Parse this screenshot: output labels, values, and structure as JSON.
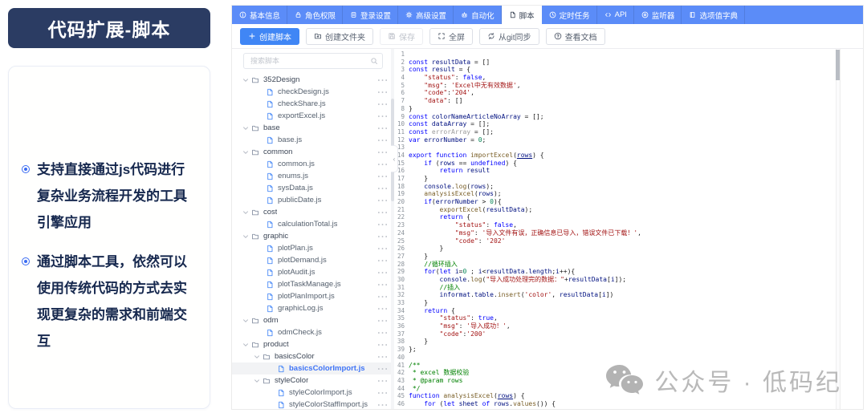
{
  "left_panel": {
    "title": "代码扩展-脚本",
    "bullets": [
      "支持直接通过js代码进行复杂业务流程开发的工具引擎应用",
      "通过脚本工具，依然可以使用传统代码的方式去实现更复杂的需求和前端交互"
    ]
  },
  "tabs": [
    {
      "id": "basic-info",
      "label": "基本信息",
      "icon": "info-icon",
      "active": false
    },
    {
      "id": "role-permission",
      "label": "角色权限",
      "icon": "lock-icon",
      "active": false
    },
    {
      "id": "login-settings",
      "label": "登录设置",
      "icon": "login-icon",
      "active": false
    },
    {
      "id": "advanced-settings",
      "label": "高级设置",
      "icon": "gear-icon",
      "active": false
    },
    {
      "id": "automation",
      "label": "自动化",
      "icon": "automation-icon",
      "active": false
    },
    {
      "id": "script",
      "label": "脚本",
      "icon": "script-icon",
      "active": true
    },
    {
      "id": "scheduled-tasks",
      "label": "定时任务",
      "icon": "clock-icon",
      "active": false
    },
    {
      "id": "api",
      "label": "API",
      "icon": "api-icon",
      "active": false
    },
    {
      "id": "listener",
      "label": "监听器",
      "icon": "monitor-icon",
      "active": false
    },
    {
      "id": "option-dict",
      "label": "选项值字典",
      "icon": "dict-icon",
      "active": false
    }
  ],
  "toolbar": [
    {
      "id": "create-script",
      "label": "创建脚本",
      "icon": "plus-icon",
      "style": "primary"
    },
    {
      "id": "create-folder",
      "label": "创建文件夹",
      "icon": "folder-add-icon",
      "style": "normal"
    },
    {
      "id": "save",
      "label": "保存",
      "icon": "save-icon",
      "style": "disabled"
    },
    {
      "id": "fullscreen",
      "label": "全屏",
      "icon": "fullscreen-icon",
      "style": "normal"
    },
    {
      "id": "git-sync",
      "label": "从git同步",
      "icon": "git-sync-icon",
      "style": "normal"
    },
    {
      "id": "view-docs",
      "label": "查看文档",
      "icon": "doc-icon",
      "style": "normal"
    }
  ],
  "file_tree": {
    "search_placeholder": "搜索脚本",
    "items": [
      {
        "type": "folder",
        "name": "352Design",
        "depth": 0
      },
      {
        "type": "file",
        "name": "checkDesign.js",
        "depth": 1
      },
      {
        "type": "file",
        "name": "checkShare.js",
        "depth": 1
      },
      {
        "type": "file",
        "name": "exportExcel.js",
        "depth": 1
      },
      {
        "type": "folder",
        "name": "base",
        "depth": 0
      },
      {
        "type": "file",
        "name": "base.js",
        "depth": 1
      },
      {
        "type": "folder",
        "name": "common",
        "depth": 0
      },
      {
        "type": "file",
        "name": "common.js",
        "depth": 1
      },
      {
        "type": "file",
        "name": "enums.js",
        "depth": 1
      },
      {
        "type": "file",
        "name": "sysData.js",
        "depth": 1
      },
      {
        "type": "file",
        "name": "publicDate.js",
        "depth": 1
      },
      {
        "type": "folder",
        "name": "cost",
        "depth": 0
      },
      {
        "type": "file",
        "name": "calculationTotal.js",
        "depth": 1
      },
      {
        "type": "folder",
        "name": "graphic",
        "depth": 0
      },
      {
        "type": "file",
        "name": "plotPlan.js",
        "depth": 1
      },
      {
        "type": "file",
        "name": "plotDemand.js",
        "depth": 1
      },
      {
        "type": "file",
        "name": "plotAudit.js",
        "depth": 1
      },
      {
        "type": "file",
        "name": "plotTaskManage.js",
        "depth": 1
      },
      {
        "type": "file",
        "name": "plotPlanImport.js",
        "depth": 1
      },
      {
        "type": "file",
        "name": "graphicLog.js",
        "depth": 1
      },
      {
        "type": "folder",
        "name": "odm",
        "depth": 0
      },
      {
        "type": "file",
        "name": "odmCheck.js",
        "depth": 1
      },
      {
        "type": "folder",
        "name": "product",
        "depth": 0
      },
      {
        "type": "folder",
        "name": "basicsColor",
        "depth": 1
      },
      {
        "type": "file",
        "name": "basicsColorImport.js",
        "depth": 2,
        "selected": true
      },
      {
        "type": "folder",
        "name": "styleColor",
        "depth": 1
      },
      {
        "type": "file",
        "name": "styleColorImport.js",
        "depth": 2
      },
      {
        "type": "file",
        "name": "styleColorStaffImport.js",
        "depth": 2
      }
    ]
  },
  "editor": {
    "lines": [
      [],
      [
        [
          "k",
          "const"
        ],
        [
          "p",
          " "
        ],
        [
          "t",
          "resultData"
        ],
        [
          "p",
          " = []"
        ]
      ],
      [
        [
          "k",
          "const"
        ],
        [
          "p",
          " "
        ],
        [
          "t",
          "result"
        ],
        [
          "p",
          " = {"
        ]
      ],
      [
        [
          "p",
          "    "
        ],
        [
          "s",
          "\"status\""
        ],
        [
          "p",
          ": "
        ],
        [
          "k",
          "false"
        ],
        [
          "p",
          ","
        ]
      ],
      [
        [
          "p",
          "    "
        ],
        [
          "s",
          "\"msg\""
        ],
        [
          "p",
          ": "
        ],
        [
          "s",
          "'Excel中无有效数据'"
        ],
        [
          "p",
          ","
        ]
      ],
      [
        [
          "p",
          "    "
        ],
        [
          "s",
          "\"code\""
        ],
        [
          "p",
          ":"
        ],
        [
          "s",
          "'204'"
        ],
        [
          "p",
          ","
        ]
      ],
      [
        [
          "p",
          "    "
        ],
        [
          "s",
          "\"data\""
        ],
        [
          "p",
          ": []"
        ]
      ],
      [
        [
          "p",
          "}"
        ]
      ],
      [
        [
          "k",
          "const"
        ],
        [
          "p",
          " "
        ],
        [
          "t",
          "colorNameArticleNoArray"
        ],
        [
          "p",
          " = [];"
        ]
      ],
      [
        [
          "k",
          "const"
        ],
        [
          "p",
          " "
        ],
        [
          "t",
          "dataArray"
        ],
        [
          "p",
          " = [];"
        ]
      ],
      [
        [
          "k",
          "const"
        ],
        [
          "p",
          " "
        ],
        [
          "g",
          "errorArray"
        ],
        [
          "p",
          " = [];"
        ]
      ],
      [
        [
          "k",
          "var"
        ],
        [
          "p",
          " "
        ],
        [
          "t",
          "errorNumber"
        ],
        [
          "p",
          " = "
        ],
        [
          "n",
          "0"
        ],
        [
          "p",
          ";"
        ]
      ],
      [],
      [
        [
          "k",
          "export"
        ],
        [
          "p",
          " "
        ],
        [
          "k",
          "function"
        ],
        [
          "p",
          " "
        ],
        [
          "f",
          "importExcel"
        ],
        [
          "p",
          "("
        ],
        [
          "u",
          "rows"
        ],
        [
          "p",
          ") {"
        ]
      ],
      [
        [
          "p",
          "    "
        ],
        [
          "k",
          "if"
        ],
        [
          "p",
          " ("
        ],
        [
          "t",
          "rows"
        ],
        [
          "p",
          " == "
        ],
        [
          "k",
          "undefined"
        ],
        [
          "p",
          ") {"
        ]
      ],
      [
        [
          "p",
          "        "
        ],
        [
          "k",
          "return"
        ],
        [
          "p",
          " "
        ],
        [
          "t",
          "result"
        ]
      ],
      [
        [
          "p",
          "    }"
        ]
      ],
      [
        [
          "p",
          "    "
        ],
        [
          "t",
          "console"
        ],
        [
          "p",
          "."
        ],
        [
          "f",
          "log"
        ],
        [
          "p",
          "("
        ],
        [
          "t",
          "rows"
        ],
        [
          "p",
          ");"
        ]
      ],
      [
        [
          "p",
          "    "
        ],
        [
          "f",
          "analysisExcel"
        ],
        [
          "p",
          "("
        ],
        [
          "t",
          "rows"
        ],
        [
          "p",
          ");"
        ]
      ],
      [
        [
          "p",
          "    "
        ],
        [
          "k",
          "if"
        ],
        [
          "p",
          "("
        ],
        [
          "t",
          "errorNumber"
        ],
        [
          "p",
          " > "
        ],
        [
          "n",
          "0"
        ],
        [
          "p",
          "){"
        ]
      ],
      [
        [
          "p",
          "        "
        ],
        [
          "f",
          "exportExcel"
        ],
        [
          "p",
          "("
        ],
        [
          "t",
          "resultData"
        ],
        [
          "p",
          ");"
        ]
      ],
      [
        [
          "p",
          "        "
        ],
        [
          "k",
          "return"
        ],
        [
          "p",
          " {"
        ]
      ],
      [
        [
          "p",
          "            "
        ],
        [
          "s",
          "\"status\""
        ],
        [
          "p",
          ": "
        ],
        [
          "k",
          "false"
        ],
        [
          "p",
          ","
        ]
      ],
      [
        [
          "p",
          "            "
        ],
        [
          "s",
          "\"msg\""
        ],
        [
          "p",
          ": "
        ],
        [
          "s",
          "'导入文件有误，正确信息已导入，错误文件已下载！'"
        ],
        [
          "p",
          ","
        ]
      ],
      [
        [
          "p",
          "            "
        ],
        [
          "s",
          "\"code\""
        ],
        [
          "p",
          ": "
        ],
        [
          "s",
          "'202'"
        ]
      ],
      [
        [
          "p",
          "        }"
        ]
      ],
      [
        [
          "p",
          "    }"
        ]
      ],
      [
        [
          "p",
          "    "
        ],
        [
          "c",
          "//循环插入"
        ]
      ],
      [
        [
          "p",
          "    "
        ],
        [
          "k",
          "for"
        ],
        [
          "p",
          "("
        ],
        [
          "k",
          "let"
        ],
        [
          "p",
          " "
        ],
        [
          "t",
          "i"
        ],
        [
          "p",
          "="
        ],
        [
          "n",
          "0"
        ],
        [
          "p",
          " ; "
        ],
        [
          "t",
          "i"
        ],
        [
          "p",
          "<"
        ],
        [
          "t",
          "resultData"
        ],
        [
          "p",
          "."
        ],
        [
          "t",
          "length"
        ],
        [
          "p",
          ";"
        ],
        [
          "t",
          "i"
        ],
        [
          "p",
          "++){"
        ]
      ],
      [
        [
          "p",
          "        "
        ],
        [
          "t",
          "console"
        ],
        [
          "p",
          "."
        ],
        [
          "f",
          "log"
        ],
        [
          "p",
          "("
        ],
        [
          "s",
          "\"导入成功处理完的数据：\""
        ],
        [
          "p",
          "+"
        ],
        [
          "t",
          "resultData"
        ],
        [
          "p",
          "["
        ],
        [
          "t",
          "i"
        ],
        [
          "p",
          "]);"
        ]
      ],
      [
        [
          "p",
          "        "
        ],
        [
          "c",
          "//插入"
        ]
      ],
      [
        [
          "p",
          "        "
        ],
        [
          "t",
          "informat"
        ],
        [
          "p",
          "."
        ],
        [
          "t",
          "table"
        ],
        [
          "p",
          "."
        ],
        [
          "f",
          "insert"
        ],
        [
          "p",
          "("
        ],
        [
          "s",
          "'color'"
        ],
        [
          "p",
          ", "
        ],
        [
          "t",
          "resultData"
        ],
        [
          "p",
          "["
        ],
        [
          "t",
          "i"
        ],
        [
          "p",
          "])"
        ]
      ],
      [
        [
          "p",
          "    }"
        ]
      ],
      [
        [
          "p",
          "    "
        ],
        [
          "k",
          "return"
        ],
        [
          "p",
          " {"
        ]
      ],
      [
        [
          "p",
          "        "
        ],
        [
          "s",
          "\"status\""
        ],
        [
          "p",
          ": "
        ],
        [
          "k",
          "true"
        ],
        [
          "p",
          ","
        ]
      ],
      [
        [
          "p",
          "        "
        ],
        [
          "s",
          "\"msg\""
        ],
        [
          "p",
          ": "
        ],
        [
          "s",
          "'导入成功！'"
        ],
        [
          "p",
          ","
        ]
      ],
      [
        [
          "p",
          "        "
        ],
        [
          "s",
          "\"code\""
        ],
        [
          "p",
          ":"
        ],
        [
          "s",
          "'200'"
        ]
      ],
      [
        [
          "p",
          "    }"
        ]
      ],
      [
        [
          "p",
          "};"
        ]
      ],
      [],
      [
        [
          "c",
          "/**"
        ]
      ],
      [
        [
          "c",
          " * excel 数据校验"
        ]
      ],
      [
        [
          "c",
          " * @param rows"
        ]
      ],
      [
        [
          "c",
          " */"
        ]
      ],
      [
        [
          "k",
          "function"
        ],
        [
          "p",
          " "
        ],
        [
          "f",
          "analysisExcel"
        ],
        [
          "p",
          "("
        ],
        [
          "u",
          "rows"
        ],
        [
          "p",
          ") {"
        ]
      ],
      [
        [
          "p",
          "    "
        ],
        [
          "k",
          "for"
        ],
        [
          "p",
          " ("
        ],
        [
          "k",
          "let"
        ],
        [
          "p",
          " "
        ],
        [
          "t",
          "sheet"
        ],
        [
          "p",
          " "
        ],
        [
          "k",
          "of"
        ],
        [
          "p",
          " "
        ],
        [
          "t",
          "rows"
        ],
        [
          "p",
          "."
        ],
        [
          "f",
          "values"
        ],
        [
          "p",
          "()) {"
        ]
      ]
    ]
  },
  "watermark": {
    "text": "公众号 · 低码纪"
  },
  "colors": {
    "banner": "#2b3c63",
    "tabbar": "#5b8cf8",
    "primary_button": "#4086f5",
    "selected_file": "#3f74f6",
    "keyword": "#0000ff",
    "string": "#a31515",
    "comment": "#008000"
  }
}
